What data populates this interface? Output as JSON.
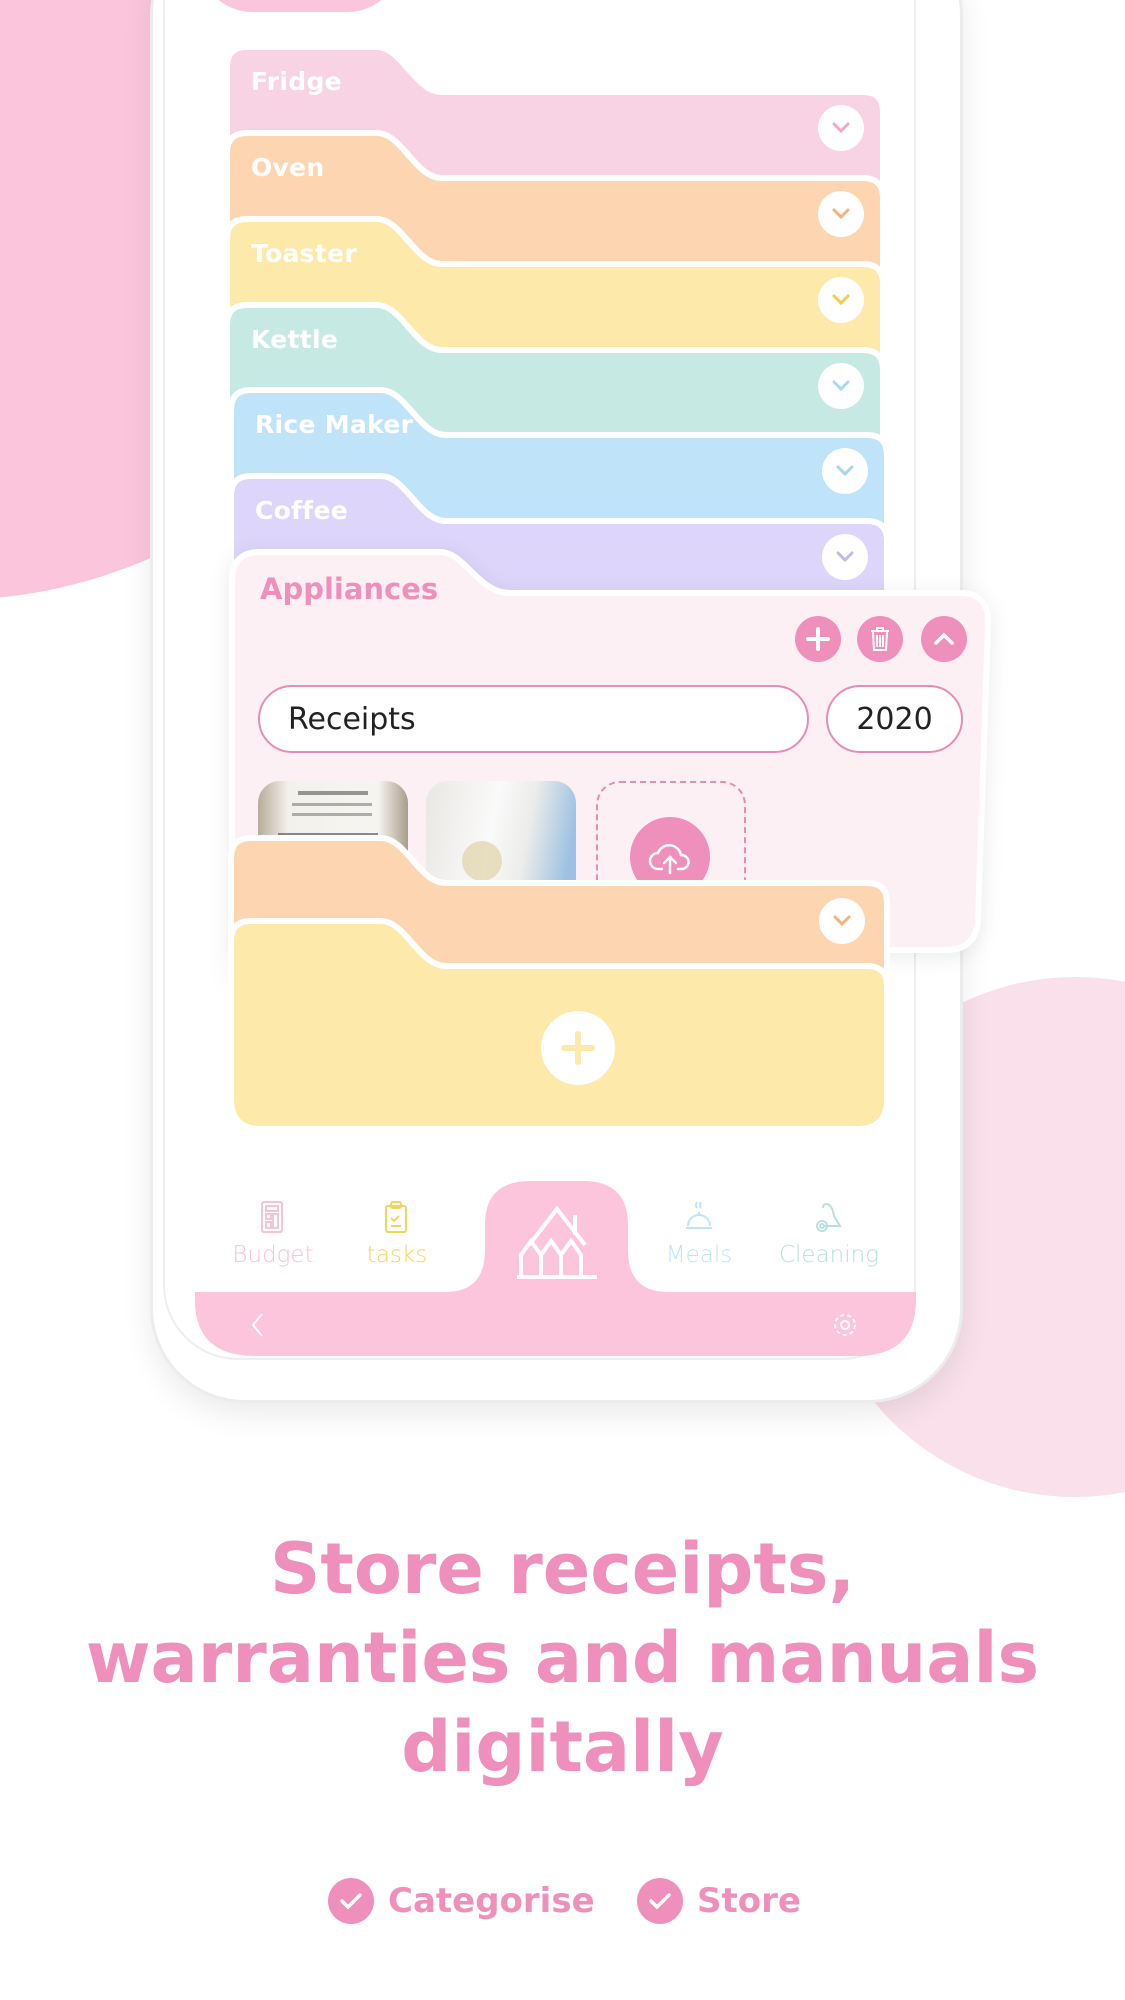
{
  "colors": {
    "accent": "#ee8fbc",
    "nav_pink": "#fcc5dc",
    "bg_circle": "#fbc6dc",
    "bg_circle2": "#f9e0ea"
  },
  "folders": [
    {
      "label": "Fridge",
      "color": "#f8d3e4",
      "chevron": "#f0a9c8"
    },
    {
      "label": "Oven",
      "color": "#fdd5b1",
      "chevron": "#f5b27a"
    },
    {
      "label": "Toaster",
      "color": "#fde9a9",
      "chevron": "#f2cb4c"
    },
    {
      "label": "Kettle",
      "color": "#c6e9e4",
      "chevron": "#a6dbf4"
    },
    {
      "label": "Rice Maker",
      "color": "#bfe4fa",
      "chevron": "#a6d6f0"
    },
    {
      "label": "Coffee",
      "color": "#ddd6fa",
      "chevron": "#c2b8ef"
    }
  ],
  "open_folder": {
    "title": "Appliances",
    "name_value": "Receipts",
    "year_value": "2020",
    "add_icon": "plus-icon",
    "delete_icon": "trash-icon",
    "collapse_icon": "chevron-up-icon",
    "upload_icon": "cloud-upload-icon"
  },
  "lower_folders": [
    {
      "color": "#fdd5b1",
      "chevron": "#f5b27a"
    },
    {
      "color": "#fde9a9",
      "add_icon": "plus-icon"
    }
  ],
  "nav": {
    "items": [
      {
        "label": "Budget",
        "icon": "calculator-icon",
        "color": "#f7c3d6"
      },
      {
        "label": "tasks",
        "icon": "clipboard-icon",
        "color": "#f5d35a"
      },
      {
        "label": "Meals",
        "icon": "cloche-icon",
        "color": "#bfe4f7"
      },
      {
        "label": "Cleaning",
        "icon": "vacuum-icon",
        "color": "#b9e0dc"
      }
    ],
    "home_icon": "house-icon",
    "back_icon": "chevron-left-icon",
    "settings_icon": "gear-icon"
  },
  "headline": [
    "Store receipts,",
    "warranties and manuals",
    "digitally"
  ],
  "features": [
    "Categorise",
    "Store"
  ]
}
